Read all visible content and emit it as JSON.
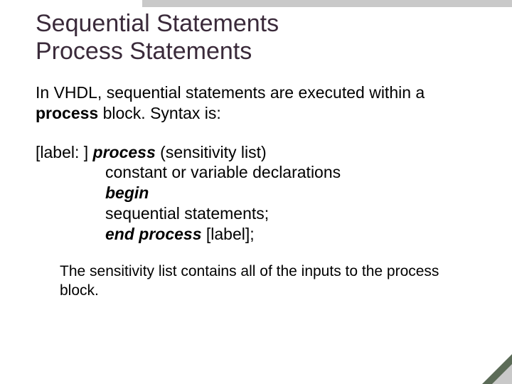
{
  "title_line1": "Sequential Statements",
  "title_line2": "Process Statements",
  "intro_part1": "In VHDL, sequential statements are executed within a ",
  "intro_bold": "process",
  "intro_part2": " block.  Syntax is:",
  "syntax": {
    "line1_pre": "[label: ] ",
    "line1_bi": "process",
    "line1_post": " (sensitivity list)",
    "line2": " constant or variable declarations",
    "line3_bi": "begin",
    "line4": " sequential statements;",
    "line5_bi": "end process",
    "line5_post": " [label];"
  },
  "note": "The sensitivity list contains all of the inputs to the process block."
}
